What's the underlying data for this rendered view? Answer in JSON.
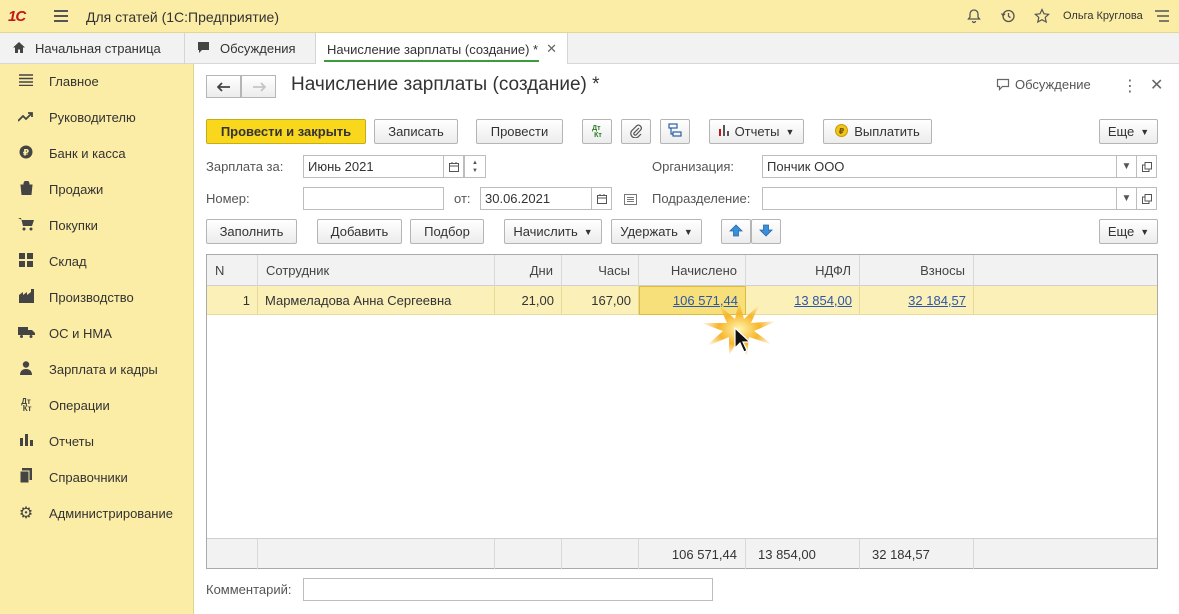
{
  "app": {
    "title": "Для статей  (1С:Предприятие)",
    "user": "Ольга Круглова"
  },
  "tabs": [
    {
      "label": "Начальная страница"
    },
    {
      "label": "Обсуждения"
    },
    {
      "label": "Начисление зарплаты (создание) *"
    }
  ],
  "sidebar": {
    "items": [
      {
        "label": "Главное",
        "icon": "menu-lines-icon"
      },
      {
        "label": "Руководителю",
        "icon": "trend-icon"
      },
      {
        "label": "Банк и касса",
        "icon": "coin-icon"
      },
      {
        "label": "Продажи",
        "icon": "bag-icon"
      },
      {
        "label": "Покупки",
        "icon": "cart-icon"
      },
      {
        "label": "Склад",
        "icon": "grid-icon"
      },
      {
        "label": "Производство",
        "icon": "factory-icon"
      },
      {
        "label": "ОС и НМА",
        "icon": "truck-icon"
      },
      {
        "label": "Зарплата и кадры",
        "icon": "person-icon"
      },
      {
        "label": "Операции",
        "icon": "dt-kt-icon"
      },
      {
        "label": "Отчеты",
        "icon": "bar-chart-icon"
      },
      {
        "label": "Справочники",
        "icon": "book-icon"
      },
      {
        "label": "Администрирование",
        "icon": "gear-icon"
      }
    ]
  },
  "form": {
    "title": "Начисление зарплаты (создание) *",
    "discussion": "Обсуждение",
    "toolbar": {
      "post_close": "Провести и закрыть",
      "save": "Записать",
      "post": "Провести",
      "reports": "Отчеты",
      "pay": "Выплатить",
      "more": "Еще"
    },
    "fields": {
      "salary_for_label": "Зарплата за:",
      "salary_for_value": "Июнь 2021",
      "org_label": "Организация:",
      "org_value": "Пончик ООО",
      "number_label": "Номер:",
      "number_value": "",
      "from_label": "от:",
      "date_value": "30.06.2021",
      "division_label": "Подразделение:",
      "division_value": "",
      "comment_label": "Комментарий:",
      "comment_value": ""
    },
    "table_toolbar": {
      "fill": "Заполнить",
      "add": "Добавить",
      "pick": "Подбор",
      "accrue": "Начислить",
      "withhold": "Удержать",
      "more": "Еще"
    },
    "table": {
      "columns": [
        "N",
        "Сотрудник",
        "Дни",
        "Часы",
        "Начислено",
        "НДФЛ",
        "Взносы"
      ],
      "rows": [
        {
          "n": "1",
          "employee": "Мармеладова Анна Сергеевна",
          "days": "21,00",
          "hours": "167,00",
          "accrued": "106 571,44",
          "ndfl": "13 854,00",
          "contrib": "32 184,57"
        }
      ],
      "totals": {
        "accrued": "106 571,44",
        "ndfl": "13 854,00",
        "contrib": "32 184,57"
      }
    }
  }
}
